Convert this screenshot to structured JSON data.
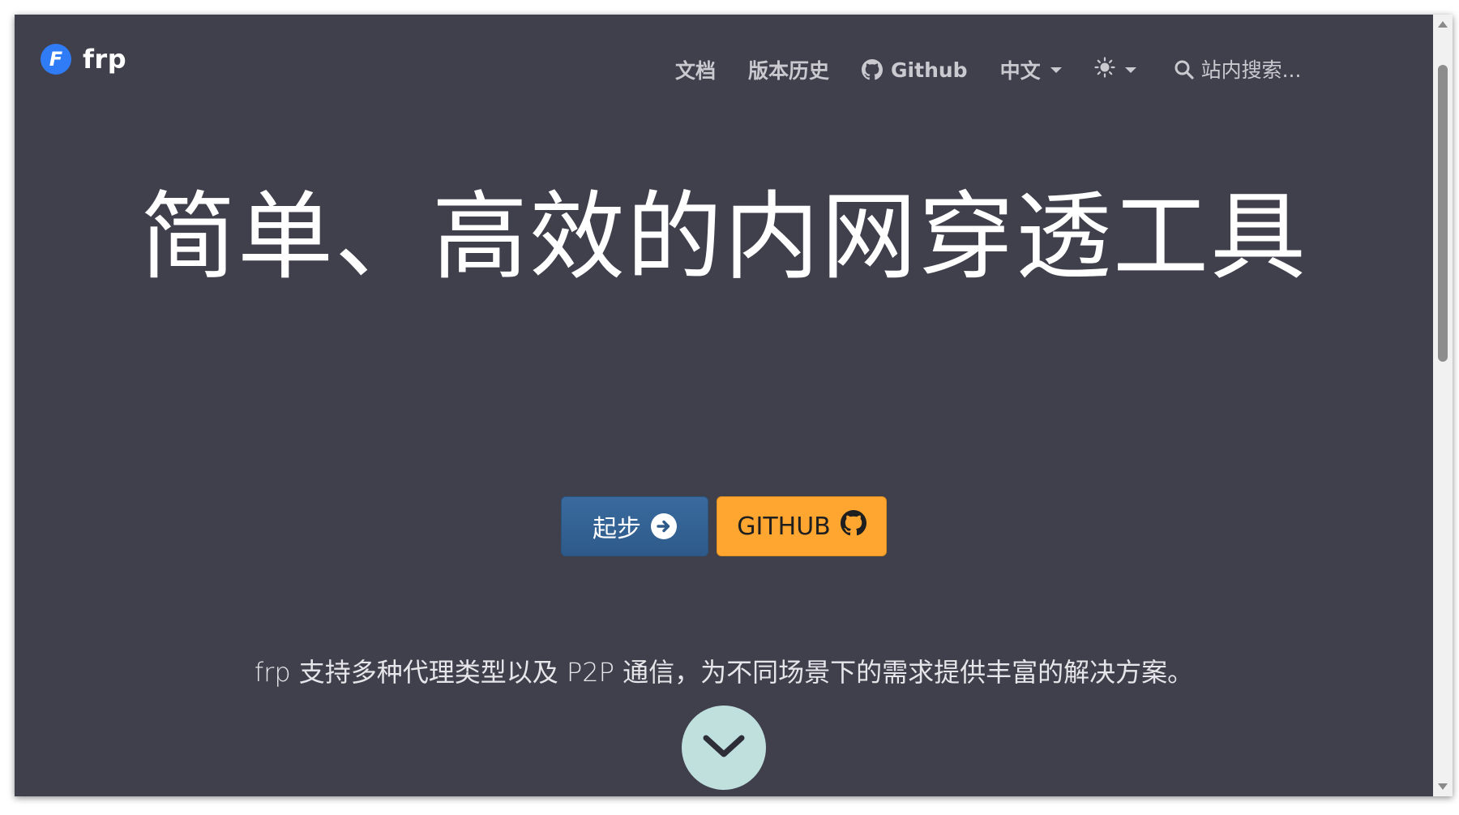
{
  "brand": {
    "name": "frp",
    "logo_letter": "F"
  },
  "nav": {
    "docs": "文档",
    "releases": "版本历史",
    "github": "Github",
    "language": "中文",
    "theme_icon": "sun-icon",
    "search_placeholder": "站内搜索..."
  },
  "hero": {
    "title": "简单、高效的内网穿透工具",
    "start_label": "起步",
    "github_label": "GITHUB",
    "tagline": "frp 支持多种代理类型以及 P2P 通信，为不同场景下的需求提供丰富的解决方案。"
  },
  "colors": {
    "background": "#403f4c",
    "start_button": "#2d5a8a",
    "github_button": "#ffa630",
    "scroll_down": "#c0e0de",
    "logo": "#2f7cf6"
  }
}
